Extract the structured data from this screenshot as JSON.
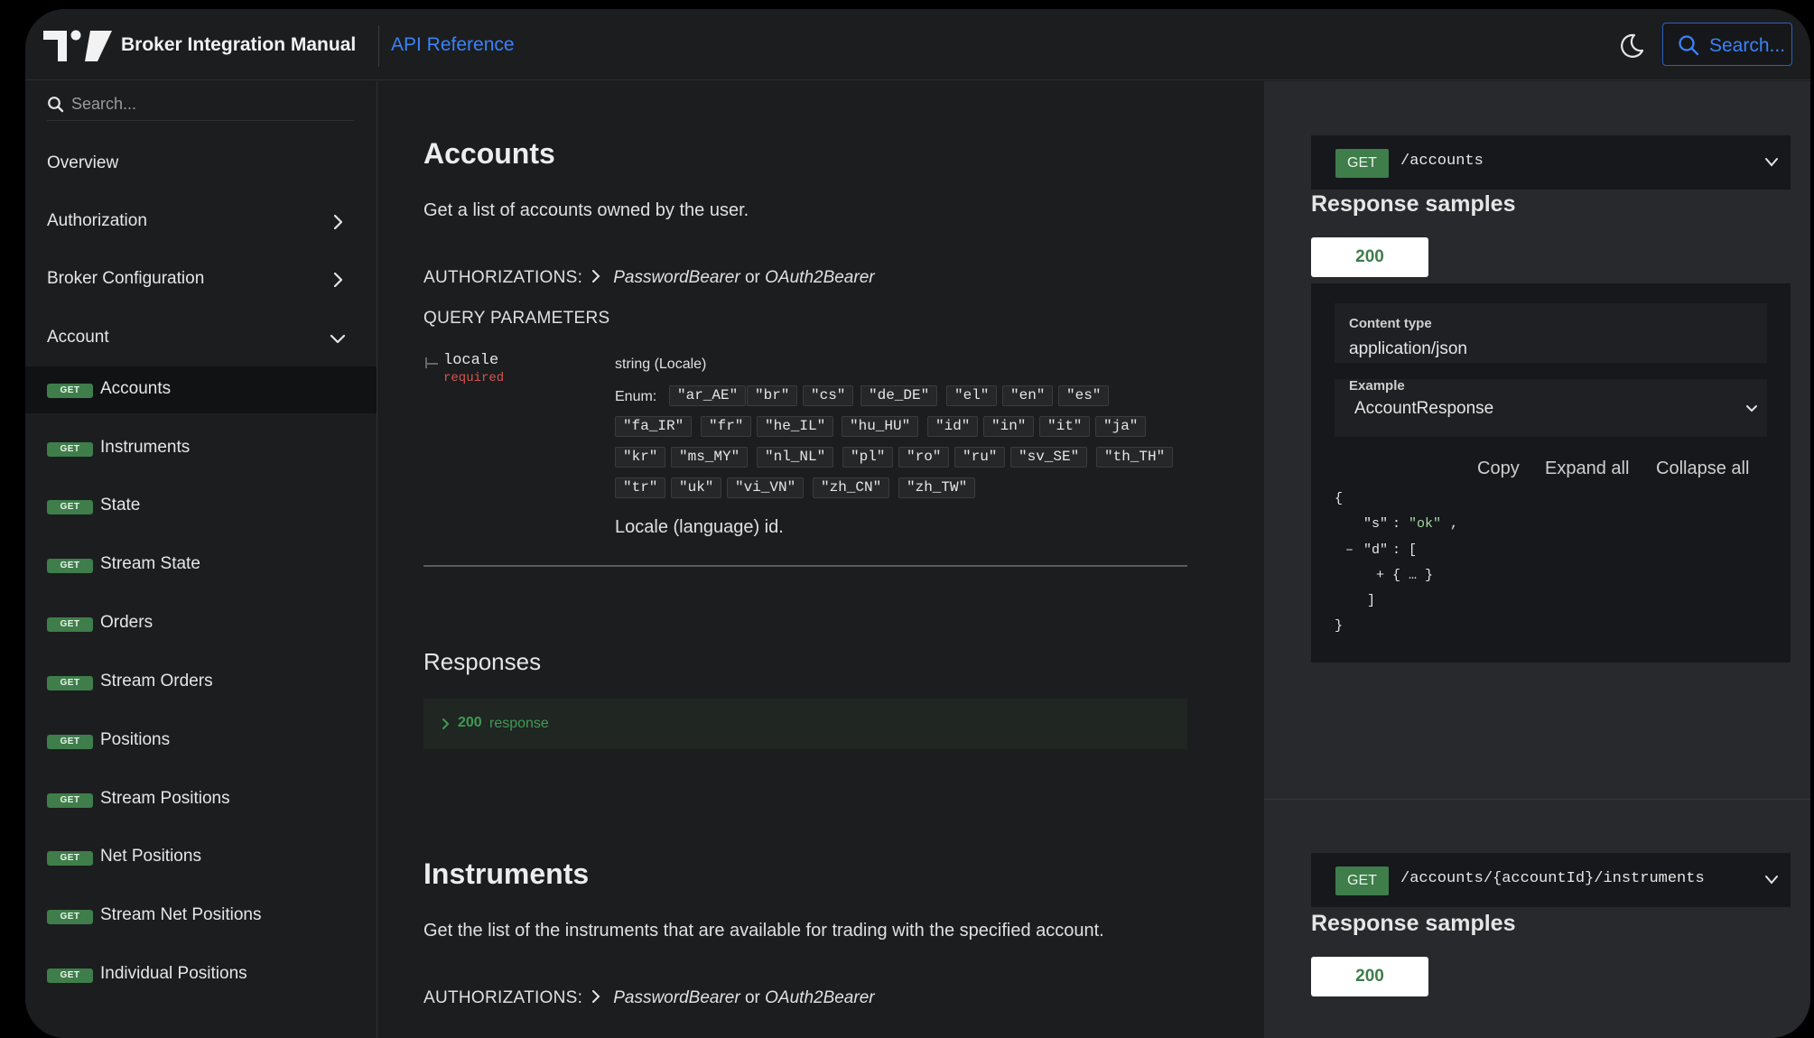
{
  "header": {
    "title": "Broker Integration Manual",
    "api_link": "API Reference",
    "search_label": "Search..."
  },
  "sidebar": {
    "search_placeholder": "Search...",
    "sections": [
      {
        "label": "Overview"
      },
      {
        "label": "Authorization"
      },
      {
        "label": "Broker Configuration"
      },
      {
        "label": "Account"
      }
    ],
    "operations": [
      {
        "method": "GET",
        "label": "Accounts"
      },
      {
        "method": "GET",
        "label": "Instruments"
      },
      {
        "method": "GET",
        "label": "State"
      },
      {
        "method": "GET",
        "label": "Stream State"
      },
      {
        "method": "GET",
        "label": "Orders"
      },
      {
        "method": "GET",
        "label": "Stream Orders"
      },
      {
        "method": "GET",
        "label": "Positions"
      },
      {
        "method": "GET",
        "label": "Stream Positions"
      },
      {
        "method": "GET",
        "label": "Net Positions"
      },
      {
        "method": "GET",
        "label": "Stream Net Positions"
      },
      {
        "method": "GET",
        "label": "Individual Positions"
      }
    ]
  },
  "accounts": {
    "title": "Accounts",
    "description": "Get a list of accounts owned by the user.",
    "auth_label": "AUTHORIZATIONS:",
    "auth_a": "PasswordBearer",
    "auth_or": "or",
    "auth_b": "OAuth2Bearer",
    "query_label": "QUERY PARAMETERS",
    "param": {
      "name": "locale",
      "required": "required",
      "type": "string (Locale)",
      "enum_label": "Enum:",
      "enum": [
        "\"ar_AE\"",
        "\"br\"",
        "\"cs\"",
        "\"de_DE\"",
        "\"el\"",
        "\"en\"",
        "\"es\"",
        "\"fa_IR\"",
        "\"fr\"",
        "\"he_IL\"",
        "\"hu_HU\"",
        "\"id\"",
        "\"in\"",
        "\"it\"",
        "\"ja\"",
        "\"kr\"",
        "\"ms_MY\"",
        "\"nl_NL\"",
        "\"pl\"",
        "\"ro\"",
        "\"ru\"",
        "\"sv_SE\"",
        "\"th_TH\"",
        "\"tr\"",
        "\"uk\"",
        "\"vi_VN\"",
        "\"zh_CN\"",
        "\"zh_TW\""
      ],
      "description": "Locale (language) id."
    },
    "responses_title": "Responses",
    "response_code": "200",
    "response_text": "response",
    "endpoint": {
      "method": "GET",
      "path": "/accounts"
    },
    "samples_title": "Response samples",
    "status_tab": "200",
    "content_type_label": "Content type",
    "content_type": "application/json",
    "example_label": "Example",
    "example_value": "AccountResponse",
    "actions": {
      "copy": "Copy",
      "expand": "Expand all",
      "collapse": "Collapse all"
    },
    "json": {
      "open": "{",
      "s_key": "\"s\"",
      "s_val": "\"ok\"",
      "d_toggle": "–",
      "d_key": "\"d\"",
      "d_open": "[",
      "item_toggle": "+",
      "item": "{ … }",
      "d_close": "]",
      "close": "}"
    }
  },
  "instruments": {
    "title": "Instruments",
    "description": "Get the list of the instruments that are available for trading with the specified account.",
    "auth_label": "AUTHORIZATIONS:",
    "auth_a": "PasswordBearer",
    "auth_or": "or",
    "auth_b": "OAuth2Bearer",
    "endpoint": {
      "method": "GET",
      "path": "/accounts/{accountId}/instruments"
    },
    "samples_title": "Response samples",
    "status_tab": "200"
  }
}
